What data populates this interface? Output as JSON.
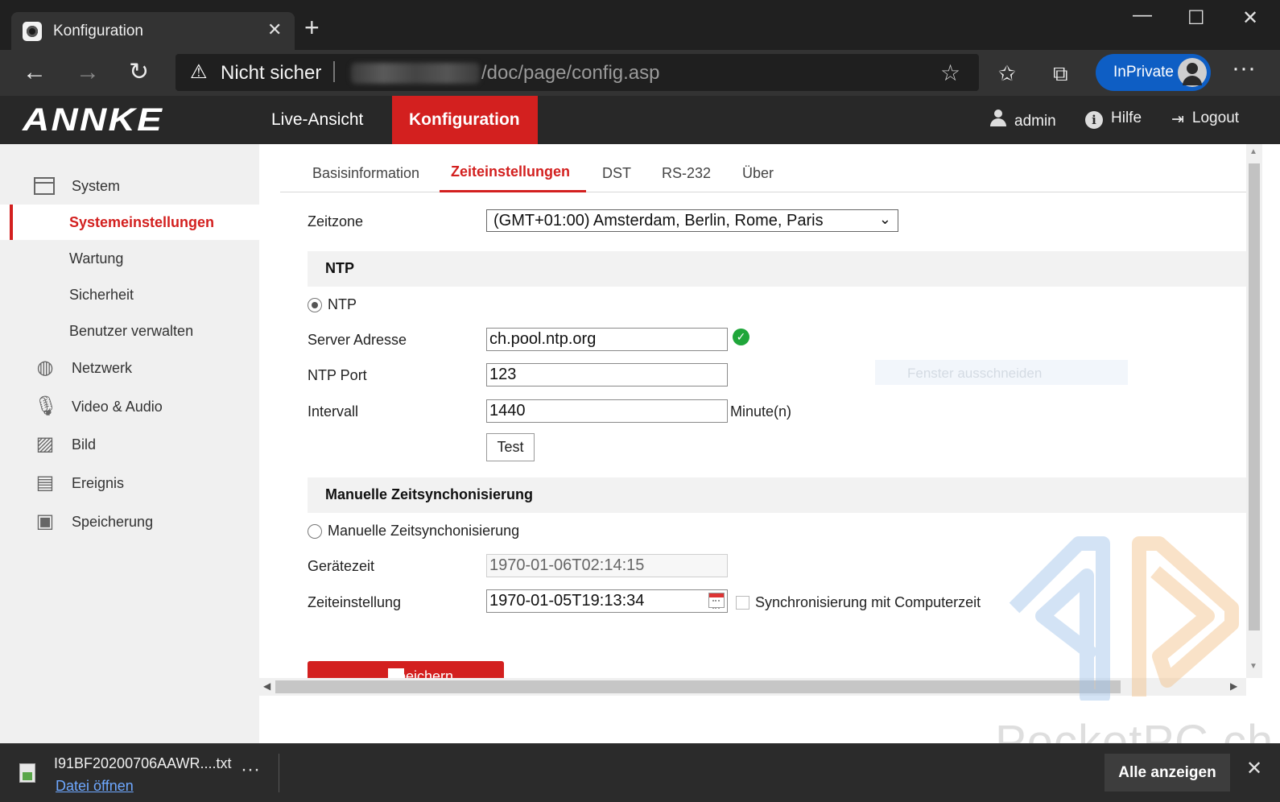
{
  "browser": {
    "tab_title": "Konfiguration",
    "tab_close": "✕",
    "new_tab": "+",
    "window_minimize": "—",
    "window_maximize": "☐",
    "window_close": "✕",
    "back": "←",
    "forward": "→",
    "reload": "↻",
    "security_warning": "Nicht sicher",
    "url_visible": "/doc/page/config.asp",
    "inprivate_label": "InPrivate",
    "more": "···"
  },
  "app": {
    "logo": "ANNKE",
    "nav": {
      "live": "Live-Ansicht",
      "config": "Konfiguration"
    },
    "header": {
      "user": "admin",
      "help": "Hilfe",
      "logout": "Logout"
    },
    "colors": {
      "accent": "#d3201f",
      "header_bg": "#282828",
      "ok_green": "#1fa63a"
    }
  },
  "sidebar": {
    "items": [
      {
        "label": "System",
        "icon": "window-icon"
      },
      {
        "label": "Systemeinstellungen",
        "active": true
      },
      {
        "label": "Wartung"
      },
      {
        "label": "Sicherheit"
      },
      {
        "label": "Benutzer verwalten"
      },
      {
        "label": "Netzwerk",
        "icon": "globe-icon"
      },
      {
        "label": "Video & Audio",
        "icon": "microphone-icon"
      },
      {
        "label": "Bild",
        "icon": "image-icon"
      },
      {
        "label": "Ereignis",
        "icon": "calendar-list-icon"
      },
      {
        "label": "Speicherung",
        "icon": "floppy-disk-icon"
      }
    ]
  },
  "tabs": [
    "Basisinformation",
    "Zeiteinstellungen",
    "DST",
    "RS-232",
    "Über"
  ],
  "form": {
    "timezone_label": "Zeitzone",
    "timezone_value": "(GMT+01:00) Amsterdam, Berlin, Rome, Paris",
    "ntp_section": "NTP",
    "ntp_radio_label": "NTP",
    "server_label": "Server Adresse",
    "server_value": "ch.pool.ntp.org",
    "port_label": "NTP Port",
    "port_value": "123",
    "interval_label": "Intervall",
    "interval_value": "1440",
    "interval_unit": "Minute(n)",
    "test_button": "Test",
    "manual_section": "Manuelle Zeitsynchonisierung",
    "manual_radio_label": "Manuelle Zeitsynchonisierung",
    "device_time_label": "Gerätezeit",
    "device_time_value": "1970-01-06T02:14:15",
    "time_setting_label": "Zeiteinstellung",
    "time_setting_value": "1970-01-05T19:13:34",
    "sync_pc_label": "Synchronisierung mit Computerzeit",
    "save_button": "Speichern",
    "ghost_tooltip": "Fenster ausschneiden"
  },
  "watermark": "PocketPC.ch",
  "download": {
    "filename": "I91BF20200706AAWR....txt",
    "open_link": "Datei öffnen",
    "more": "···",
    "show_all": "Alle anzeigen",
    "close": "✕"
  }
}
